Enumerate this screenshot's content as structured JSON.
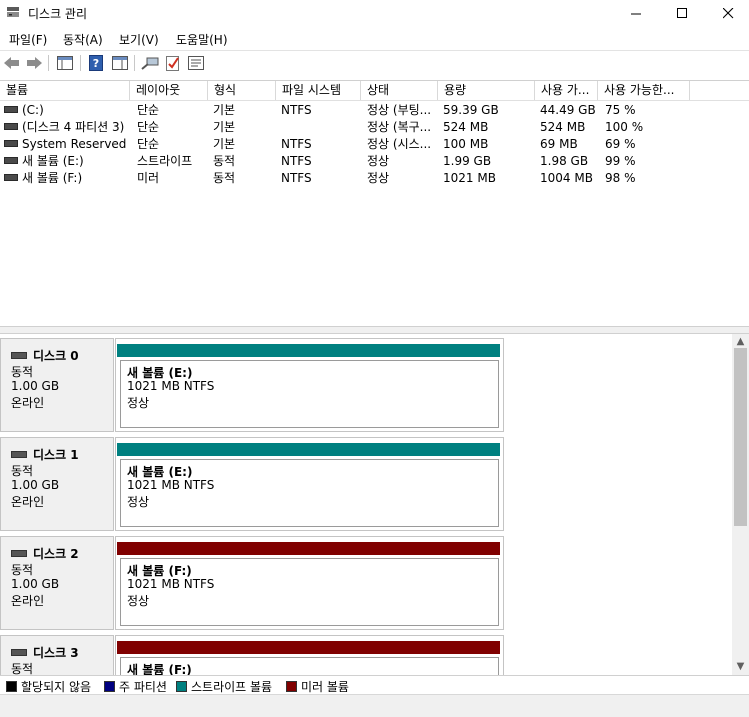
{
  "window": {
    "title": "디스크 관리",
    "app_icon": "disk-management-icon"
  },
  "menu": [
    "파일(F)",
    "동작(A)",
    "보기(V)",
    "도움말(H)"
  ],
  "toolbar_icons": [
    "back-arrow-icon",
    "forward-arrow-icon",
    "console-tree-icon",
    "help-icon",
    "show-pane-icon",
    "connect-icon",
    "checkmark-icon",
    "properties-icon"
  ],
  "columns": [
    "볼륨",
    "레이아웃",
    "형식",
    "파일 시스템",
    "상태",
    "용량",
    "사용 가...",
    "사용 가능한..."
  ],
  "volumes": [
    [
      "(C:)",
      "단순",
      "기본",
      "NTFS",
      "정상 (부팅...",
      "59.39 GB",
      "44.49 GB",
      "75 %"
    ],
    [
      "(디스크 4 파티션 3)",
      "단순",
      "기본",
      "",
      "정상 (복구...",
      "524 MB",
      "524 MB",
      "100 %"
    ],
    [
      "System Reserved",
      "단순",
      "기본",
      "NTFS",
      "정상 (시스...",
      "100 MB",
      "69 MB",
      "69 %"
    ],
    [
      "새 볼륨 (E:)",
      "스트라이프",
      "동적",
      "NTFS",
      "정상",
      "1.99 GB",
      "1.98 GB",
      "99 %"
    ],
    [
      "새 볼륨 (F:)",
      "미러",
      "동적",
      "NTFS",
      "정상",
      "1021 MB",
      "1004 MB",
      "98 %"
    ]
  ],
  "disks": [
    {
      "name": "디스크 0",
      "type": "동적",
      "size": "1.00 GB",
      "status": "온라인",
      "partition": {
        "title": "새 볼륨  (E:)",
        "size": "1021 MB NTFS",
        "status": "정상",
        "color": "#008080"
      }
    },
    {
      "name": "디스크 1",
      "type": "동적",
      "size": "1.00 GB",
      "status": "온라인",
      "partition": {
        "title": "새 볼륨  (E:)",
        "size": "1021 MB NTFS",
        "status": "정상",
        "color": "#008080"
      }
    },
    {
      "name": "디스크 2",
      "type": "동적",
      "size": "1.00 GB",
      "status": "온라인",
      "partition": {
        "title": "새 볼륨  (F:)",
        "size": "1021 MB NTFS",
        "status": "정상",
        "color": "#800000"
      }
    },
    {
      "name": "디스크 3",
      "type": "동적",
      "size": "",
      "status": "",
      "partition": {
        "title": "새 볼륨  (F:)",
        "size": "",
        "status": "",
        "color": "#800000"
      }
    }
  ],
  "legend": [
    {
      "label": "할당되지 않음",
      "color": "#000000"
    },
    {
      "label": "주 파티션",
      "color": "#000080"
    },
    {
      "label": "스트라이프 볼륨",
      "color": "#008080"
    },
    {
      "label": "미러 볼륨",
      "color": "#800000"
    }
  ]
}
